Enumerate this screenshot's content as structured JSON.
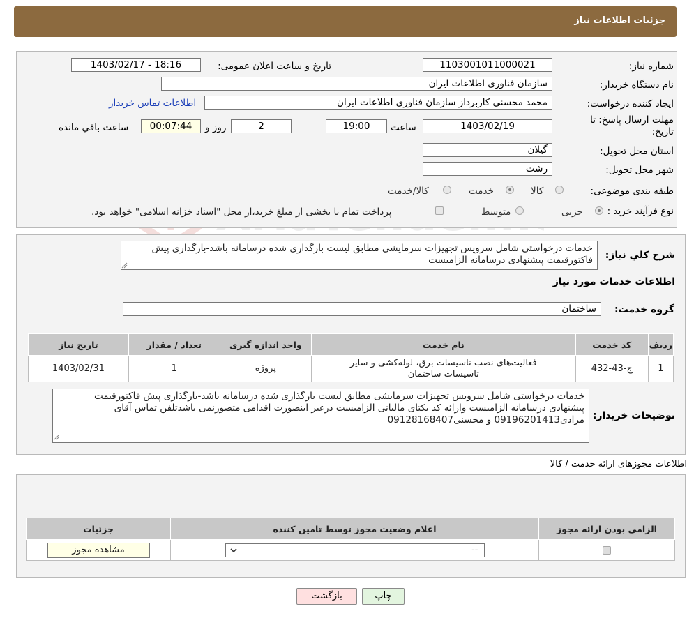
{
  "header": {
    "title": "جزئیات اطلاعات نیاز"
  },
  "info": {
    "need_number_label": "شماره نیاز:",
    "need_number": "1103001011000021",
    "announce_label": "تاریخ و ساعت اعلان عمومی:",
    "announce_value": "1403/02/17 - 18:16",
    "buyer_org_label": "نام دستگاه خریدار:",
    "buyer_org": "سازمان فناوری اطلاعات ایران",
    "creator_label": "ایجاد کننده درخواست:",
    "creator": "محمد محسنی کاربرداز سازمان فناوری اطلاعات ایران",
    "contact_link": "اطلاعات تماس خریدار",
    "deadline_label_1": "مهلت ارسال پاسخ: تا",
    "deadline_label_2": "تاریخ:",
    "deadline_date": "1403/02/19",
    "time_label": "ساعت",
    "deadline_time": "19:00",
    "days_value": "2",
    "days_label": "روز و",
    "remaining_value": "00:07:44",
    "remaining_label": "ساعت باقي مانده",
    "province_label": "استان محل تحویل:",
    "province": "گیلان",
    "city_label": "شهر محل تحویل:",
    "city": "رشت",
    "category_label": "طبقه بندی موضوعی:",
    "category_options": [
      "کالا",
      "خدمت",
      "کالا/خدمت"
    ],
    "category_selected": "خدمت",
    "process_label": "نوع فرآیند خرید :",
    "process_options": [
      "جزیی",
      "متوسط"
    ],
    "payment_note": "پرداخت تمام یا بخشی از مبلغ خرید،از محل \"اسناد خزانه اسلامی\" خواهد بود."
  },
  "summary": {
    "label": "شرح کلي نياز:",
    "text": "خدمات درخواستی شامل سرویس تجهیزات سرمایشی مطابق لیست بارگذاری شده درسامانه باشد-بارگذاری پیش فاکتورقیمت پیشنهادی درسامانه  الزامیست",
    "services_heading": "اطلاعات خدمات مورد نياز",
    "group_label": "گروه خدمت:",
    "group_value": "ساختمان"
  },
  "services_table": {
    "headers": [
      "رديف",
      "کد خدمت",
      "نام خدمت",
      "واحد اندازه گیری",
      "تعداد / مقدار",
      "تاریخ نیاز"
    ],
    "rows": [
      {
        "row": "1",
        "code": "ج-43-432",
        "name": "فعالیت‌های نصب تاسیسات برق، لوله‌کشی و سایر تاسیسات ساختمان",
        "unit": "پروژه",
        "qty": "1",
        "date": "1403/02/31"
      }
    ]
  },
  "buyer_notes": {
    "label": "توضیحات خریدار:",
    "text": "خدمات درخواستی شامل سرویس تجهیزات سرمایشی مطابق لیست بارگذاری شده درسامانه باشد-بارگذاری پیش فاکتورقیمت پیشنهادی درسامانه  الزامیست وارائه کد یکتای مالیاتی الزامیست درغیر اینصورت اقدامی متصورنمی باشدتلفن تماس آقای مرادی09196201413 و محسنی09128168407"
  },
  "permits": {
    "title": "اطلاعات مجوزهای ارائه خدمت / کالا",
    "headers": [
      "الزامی بودن ارائه مجوز",
      "اعلام وضعیت مجوز توسط تامین کننده",
      "جزئیات"
    ],
    "select_value": "--",
    "view_button": "مشاهده مجوز"
  },
  "footer": {
    "print_label": "چاپ",
    "back_label": "بازگشت"
  },
  "watermark": {
    "text": "AriaTender.neT"
  },
  "colors": {
    "header_bg": "#8c6a3f",
    "back_btn_bg": "#ffe0e0",
    "print_btn_bg": "#e3f5df",
    "link": "#1a3eb8"
  }
}
